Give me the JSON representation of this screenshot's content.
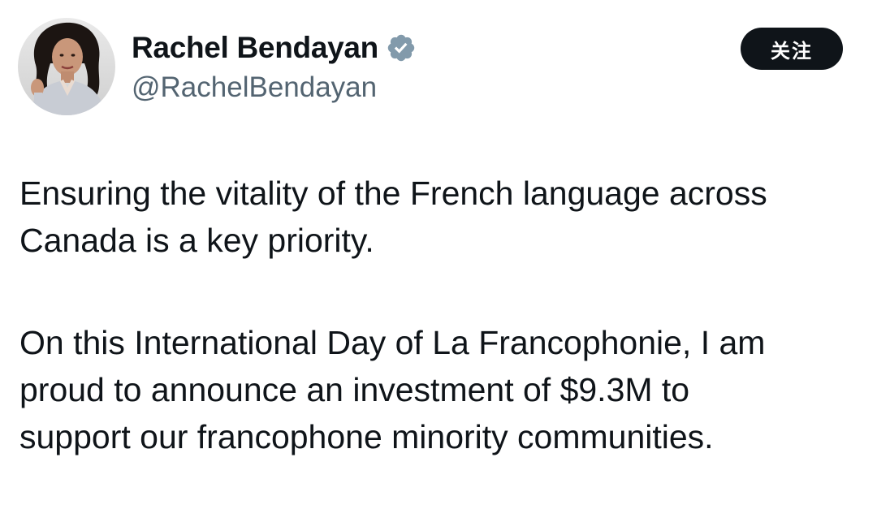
{
  "author": {
    "display_name": "Rachel Bendayan",
    "handle": "@RachelBendayan",
    "verified": true
  },
  "follow_button": {
    "label": "关注"
  },
  "tweet": {
    "paragraph_1_line_1": "Ensuring the vitality of the French language across",
    "paragraph_1_line_2": "Canada is a key priority.",
    "paragraph_2_line_1": "On this International Day of La Francophonie, I am",
    "paragraph_2_line_2": "proud to announce an investment of $9.3M to",
    "paragraph_2_line_3": "support our francophone minority communities."
  },
  "icons": {
    "verified": "verified-badge-icon",
    "avatar": "profile-photo"
  },
  "colors": {
    "text_primary": "#0f1419",
    "text_secondary": "#536471",
    "button_bg": "#0f1419",
    "button_text": "#ffffff",
    "badge": "#829aab"
  }
}
